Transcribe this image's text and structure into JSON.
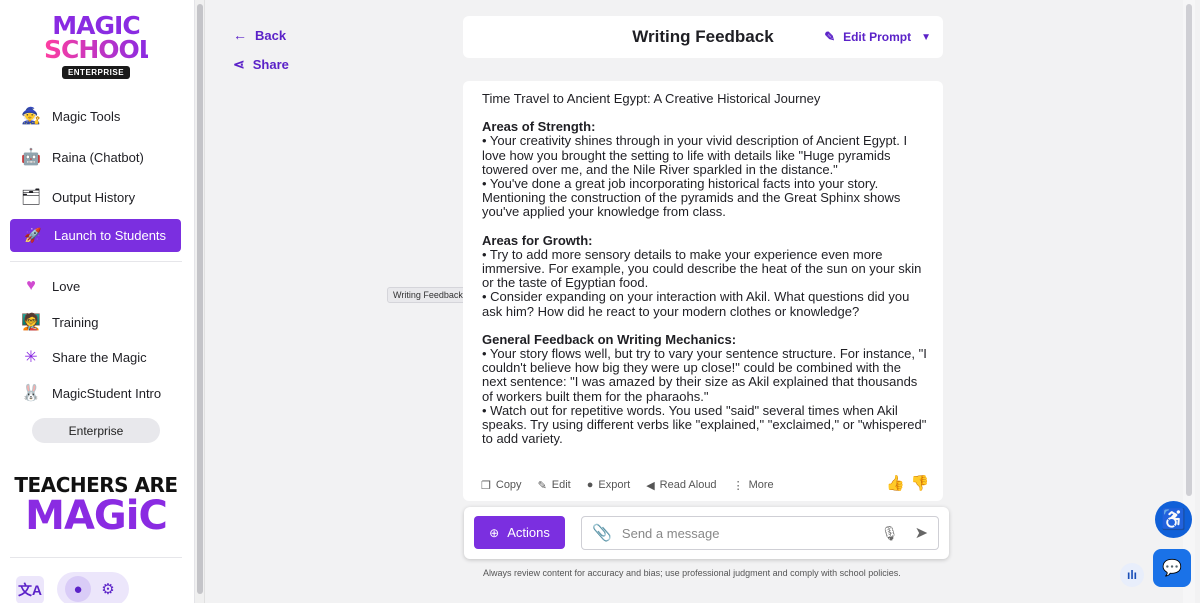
{
  "sidebar": {
    "logo": {
      "line1": "MAGIC",
      "line2": "SCHOOL",
      "badge": "ENTERPRISE"
    },
    "items": [
      {
        "label": "Magic Tools",
        "icon": "magic-tools-icon"
      },
      {
        "label": "Raina (Chatbot)",
        "icon": "raina-icon"
      },
      {
        "label": "Output History",
        "icon": "output-history-icon"
      }
    ],
    "launch": {
      "label": "Launch to Students",
      "icon": "rocket-icon"
    },
    "secondary": [
      {
        "label": "Love",
        "icon": "heart-icon"
      },
      {
        "label": "Training",
        "icon": "training-icon"
      },
      {
        "label": "Share the Magic",
        "icon": "share-magic-icon"
      },
      {
        "label": "MagicStudent Intro",
        "icon": "magicstudent-icon"
      }
    ],
    "plan_pill": "Enterprise",
    "tagline": {
      "line1": "TEACHERS ARE",
      "line2": "MAGiC"
    }
  },
  "nav": {
    "back": "Back",
    "share": "Share"
  },
  "header": {
    "title": "Writing Feedback",
    "edit_prompt": "Edit Prompt"
  },
  "tooltip": "Writing Feedback",
  "content": {
    "heading": "Time Travel to Ancient Egypt: A Creative Historical Journey",
    "strength_title": "Areas of Strength:",
    "strength_1": "• Your creativity shines through in your vivid description of Ancient Egypt. I love how you brought the setting to life with details like \"Huge pyramids towered over me, and the Nile River sparkled in the distance.\"",
    "strength_2": "• You've done a great job incorporating historical facts into your story. Mentioning the construction of the pyramids and the Great Sphinx shows you've applied your knowledge from class.",
    "growth_title": "Areas for Growth:",
    "growth_1": "• Try to add more sensory details to make your experience even more immersive. For example, you could describe the heat of the sun on your skin or the taste of Egyptian food.",
    "growth_2": "• Consider expanding on your interaction with Akil. What questions did you ask him? How did he react to your modern clothes or knowledge?",
    "mechanics_title": "General Feedback on Writing Mechanics:",
    "mechanics_1": "• Your story flows well, but try to vary your sentence structure. For instance, \"I couldn't believe how big they were up close!\" could be combined with the next sentence: \"I was amazed by their size as Akil explained that thousands of workers built them for the pharaohs.\"",
    "mechanics_2": "• Watch out for repetitive words. You used \"said\" several times when Akil speaks. Try using different verbs like \"explained,\" \"exclaimed,\" or \"whispered\" to add variety."
  },
  "toolbar": {
    "copy": "Copy",
    "edit": "Edit",
    "export": "Export",
    "read_aloud": "Read Aloud",
    "more": "More"
  },
  "composer": {
    "actions": "Actions",
    "placeholder": "Send a message"
  },
  "disclaimer": "Always review content for accuracy and bias; use professional judgment and comply with school policies.",
  "colors": {
    "accent": "#7b2fe0",
    "link": "#5b22c8",
    "brand_blue": "#1060d8"
  }
}
